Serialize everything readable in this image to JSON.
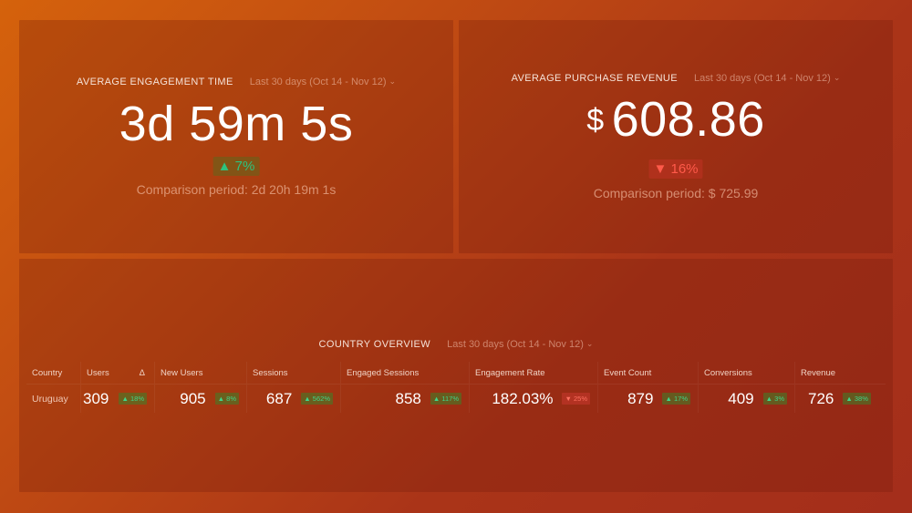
{
  "engagement": {
    "title": "AVERAGE ENGAGEMENT TIME",
    "range": "Last 30 days (Oct 14 - Nov 12)",
    "value": "3d 59m 5s",
    "change": "▲ 7%",
    "change_direction": "up",
    "comparison": "Comparison period: 2d 20h 19m 1s"
  },
  "revenue": {
    "title": "AVERAGE PURCHASE REVENUE",
    "range": "Last 30 days (Oct 14 - Nov 12)",
    "currency": "$",
    "value": "608.86",
    "change": "▼ 16%",
    "change_direction": "down",
    "comparison": "Comparison period: $ 725.99"
  },
  "country": {
    "title": "COUNTRY OVERVIEW",
    "range": "Last 30 days (Oct 14 - Nov 12)",
    "columns": {
      "country": "Country",
      "users": "Users",
      "users_delta": "Δ",
      "new_users": "New Users",
      "sessions": "Sessions",
      "engaged_sessions": "Engaged Sessions",
      "engagement_rate": "Engagement Rate",
      "event_count": "Event Count",
      "conversions": "Conversions",
      "revenue": "Revenue"
    },
    "rows": [
      {
        "country": "Uruguay",
        "users": "309",
        "users_change": "▲ 18%",
        "new_users": "905",
        "new_users_change": "▲ 8%",
        "sessions": "687",
        "sessions_change": "▲ 562%",
        "engaged_sessions": "858",
        "engaged_sessions_change": "▲ 117%",
        "engagement_rate": "182.03%",
        "engagement_rate_change": "▼ 25%",
        "event_count": "879",
        "event_count_change": "▲ 17%",
        "conversions": "409",
        "conversions_change": "▲ 3%",
        "revenue": "726",
        "revenue_change": "▲ 38%"
      }
    ]
  },
  "icons": {
    "dropdown": "chevron-down-icon"
  },
  "colors": {
    "up": "#2ec27e",
    "down": "#ff5a4a",
    "background_start": "#d5620c",
    "background_end": "#a42e1b"
  }
}
